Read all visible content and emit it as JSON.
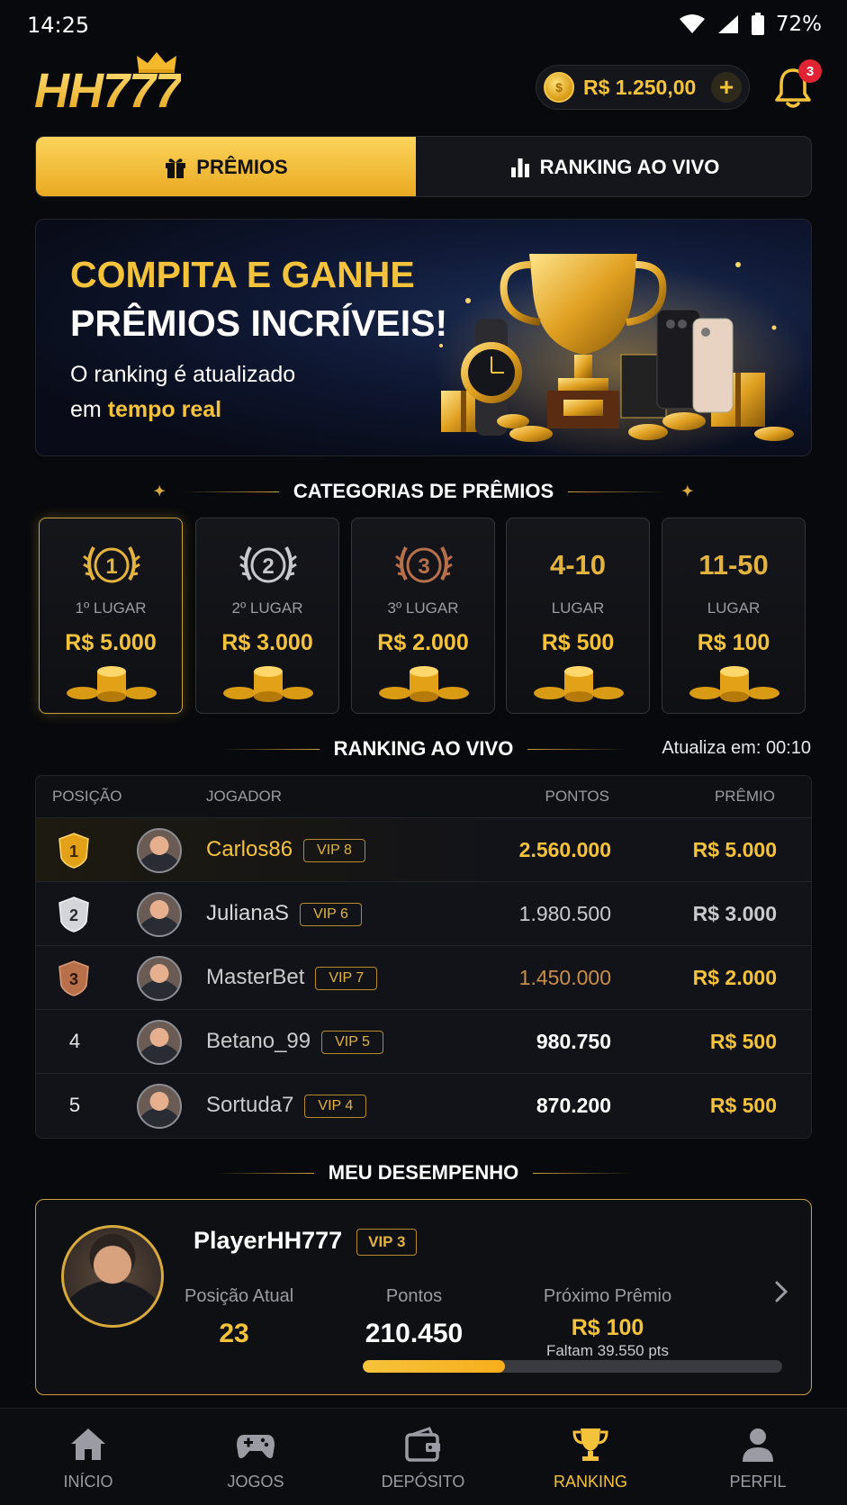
{
  "status_bar": {
    "time": "14:25",
    "battery": "72%"
  },
  "header": {
    "logo": "HH777",
    "balance": "R$ 1.250,00",
    "notifications": "3"
  },
  "tabs": [
    {
      "label": "PRÊMIOS",
      "active": true
    },
    {
      "label": "RANKING AO VIVO",
      "active": false
    }
  ],
  "banner": {
    "title_line1": "COMPITA E GANHE",
    "title_line2": "PRÊMIOS INCRÍVEIS!",
    "subtitle_line1": "O ranking é atualizado",
    "subtitle_em_prefix": "em ",
    "subtitle_highlight": "tempo real"
  },
  "categories": {
    "title": "CATEGORIAS DE PRÊMIOS",
    "items": [
      {
        "rank": "1",
        "label": "1º LUGAR",
        "prize": "R$ 5.000",
        "medal_color": "#e3b340"
      },
      {
        "rank": "2",
        "label": "2º LUGAR",
        "prize": "R$ 3.000",
        "medal_color": "#c8c9ce"
      },
      {
        "rank": "3",
        "label": "3º LUGAR",
        "prize": "R$ 2.000",
        "medal_color": "#b7704a"
      },
      {
        "rank": "4-10",
        "label": "LUGAR",
        "prize": "R$ 500"
      },
      {
        "rank": "11-50",
        "label": "LUGAR",
        "prize": "R$ 100"
      }
    ]
  },
  "ranking": {
    "title": "RANKING AO VIVO",
    "update_label": "Atualiza em: 00:10",
    "columns": {
      "position": "POSIÇÃO",
      "player": "JOGADOR",
      "points": "PONTOS",
      "prize": "PRÊMIO"
    },
    "rows": [
      {
        "position": "1",
        "name": "Carlos86",
        "vip": "VIP 8",
        "points": "2.560.000",
        "prize": "R$ 5.000"
      },
      {
        "position": "2",
        "name": "JulianaS",
        "vip": "VIP 6",
        "points": "1.980.500",
        "prize": "R$ 3.000"
      },
      {
        "position": "3",
        "name": "MasterBet",
        "vip": "VIP 7",
        "points": "1.450.000",
        "prize": "R$ 2.000"
      },
      {
        "position": "4",
        "name": "Betano_99",
        "vip": "VIP 5",
        "points": "980.750",
        "prize": "R$ 500"
      },
      {
        "position": "5",
        "name": "Sortuda7",
        "vip": "VIP 4",
        "points": "870.200",
        "prize": "R$ 500"
      }
    ]
  },
  "performance": {
    "title": "MEU DESEMPENHO",
    "name": "PlayerHH777",
    "vip": "VIP 3",
    "position_label": "Posição Atual",
    "position_value": "23",
    "points_label": "Pontos",
    "points_value": "210.450",
    "next_label": "Próximo Prêmio",
    "next_value": "R$ 100",
    "remaining": "Faltam 39.550 pts",
    "progress": 0.34
  },
  "nav": [
    {
      "label": "INÍCIO",
      "icon": "home-icon",
      "active": false
    },
    {
      "label": "JOGOS",
      "icon": "gamepad-icon",
      "active": false
    },
    {
      "label": "DEPÓSITO",
      "icon": "wallet-icon",
      "active": false
    },
    {
      "label": "RANKING",
      "icon": "trophy-icon",
      "active": true
    },
    {
      "label": "PERFIL",
      "icon": "user-icon",
      "active": false
    }
  ],
  "colors": {
    "accent": "#f5c33b",
    "background": "#08090c",
    "badge": "#e02434"
  }
}
